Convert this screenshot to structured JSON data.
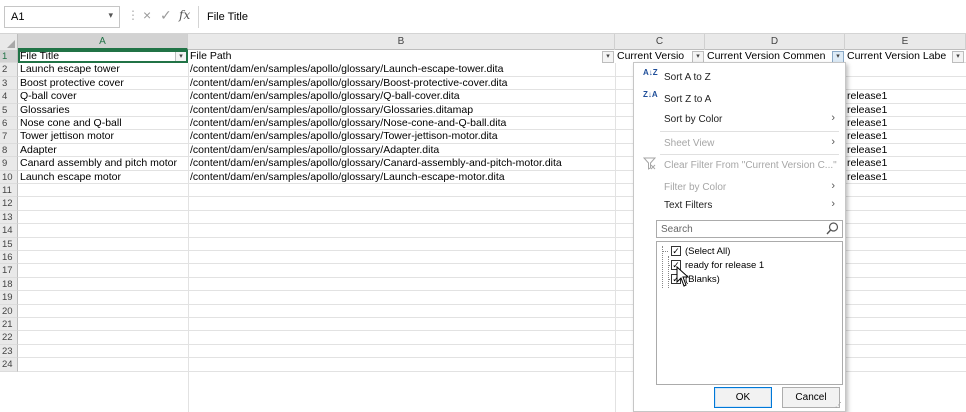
{
  "formula_bar": {
    "name_box": "A1",
    "name_box_arrow": "▾",
    "separator": "⋮",
    "cancel_icon": "×",
    "enter_icon": "✓",
    "fx_icon": "fx",
    "content": "File Title"
  },
  "columns": [
    "A",
    "B",
    "C",
    "D",
    "E"
  ],
  "row_numbers": [
    "1",
    "2",
    "3",
    "4",
    "5",
    "6",
    "7",
    "8",
    "9",
    "10",
    "11",
    "12",
    "13",
    "14",
    "15",
    "16",
    "17",
    "18",
    "19",
    "20",
    "21",
    "22",
    "23",
    "24"
  ],
  "table": {
    "headers": [
      "File Title",
      "File Path",
      "Current Versio",
      "Current Version Commen",
      "Current Version Labe"
    ],
    "filter_arrow": "▾",
    "rows": [
      {
        "title": "Launch escape tower",
        "path": "/content/dam/en/samples/apollo/glossary/Launch-escape-tower.dita",
        "label": ""
      },
      {
        "title": "Boost protective cover",
        "path": "/content/dam/en/samples/apollo/glossary/Boost-protective-cover.dita",
        "label": ""
      },
      {
        "title": "Q-ball cover",
        "path": "/content/dam/en/samples/apollo/glossary/Q-ball-cover.dita",
        "label": "release1"
      },
      {
        "title": "Glossaries",
        "path": "/content/dam/en/samples/apollo/glossary/Glossaries.ditamap",
        "label": "release1"
      },
      {
        "title": "Nose cone and Q-ball",
        "path": "/content/dam/en/samples/apollo/glossary/Nose-cone-and-Q-ball.dita",
        "label": "release1"
      },
      {
        "title": "Tower jettison motor",
        "path": "/content/dam/en/samples/apollo/glossary/Tower-jettison-motor.dita",
        "label": "release1"
      },
      {
        "title": "Adapter",
        "path": "/content/dam/en/samples/apollo/glossary/Adapter.dita",
        "label": "release1"
      },
      {
        "title": "Canard assembly and pitch motor",
        "path": "/content/dam/en/samples/apollo/glossary/Canard-assembly-and-pitch-motor.dita",
        "label": "release1"
      },
      {
        "title": "Launch escape motor",
        "path": "/content/dam/en/samples/apollo/glossary/Launch-escape-motor.dita",
        "label": "release1"
      }
    ]
  },
  "filter_menu": {
    "sort_az_icon": "A↓Z",
    "sort_za_icon": "Z↓A",
    "sort_az": "Sort A to Z",
    "sort_za": "Sort Z to A",
    "sort_by_color": "Sort by Color",
    "sheet_view": "Sheet View",
    "clear_filter": "Clear Filter From \"Current Version C...\"",
    "filter_by_color": "Filter by Color",
    "text_filters": "Text Filters",
    "submenu_arrow": "›",
    "search_placeholder": "Search",
    "checkbox_mark": "✓",
    "options": [
      {
        "label": "(Select All)",
        "checked": true
      },
      {
        "label": "ready for release 1",
        "checked": true
      },
      {
        "label": "(Blanks)",
        "checked": true
      }
    ],
    "ok": "OK",
    "cancel": "Cancel",
    "resize_grip": "⋰"
  }
}
